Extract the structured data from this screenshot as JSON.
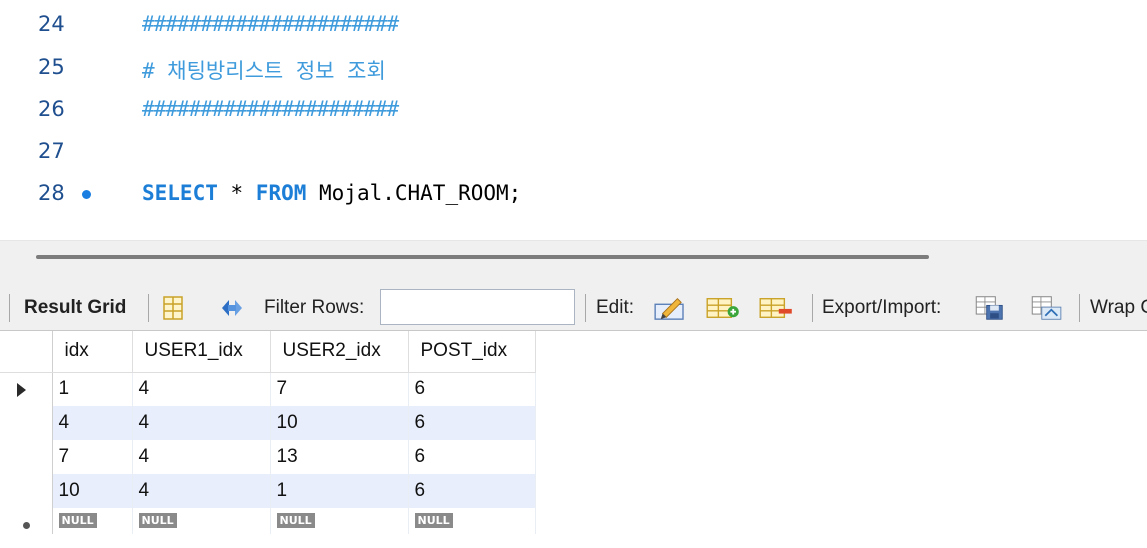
{
  "editor": {
    "lines": [
      {
        "no": "24",
        "text": "######################"
      },
      {
        "no": "25",
        "text": "# 채팅방리스트 정보 조회"
      },
      {
        "no": "26",
        "text": "######################"
      },
      {
        "no": "27",
        "text": ""
      },
      {
        "no": "28",
        "kw1": "SELECT",
        "mid": " * ",
        "kw2": "FROM",
        "rest": " Mojal.CHAT_ROOM;"
      }
    ]
  },
  "toolbar": {
    "result_grid": "Result Grid",
    "filter_rows": "Filter Rows:",
    "filter_value": "",
    "edit": "Edit:",
    "export_import": "Export/Import:",
    "wrap": "Wrap C"
  },
  "grid": {
    "columns": [
      "idx",
      "USER1_idx",
      "USER2_idx",
      "POST_idx"
    ],
    "rows": [
      [
        "1",
        "4",
        "7",
        "6"
      ],
      [
        "4",
        "4",
        "10",
        "6"
      ],
      [
        "7",
        "4",
        "13",
        "6"
      ],
      [
        "10",
        "4",
        "1",
        "6"
      ]
    ],
    "null_label": "NULL"
  },
  "colors": {
    "keyword": "#1c7ed6",
    "comment": "#3f9bdc",
    "alt_row": "#e8eefb",
    "line_number": "#1f4f8f"
  }
}
